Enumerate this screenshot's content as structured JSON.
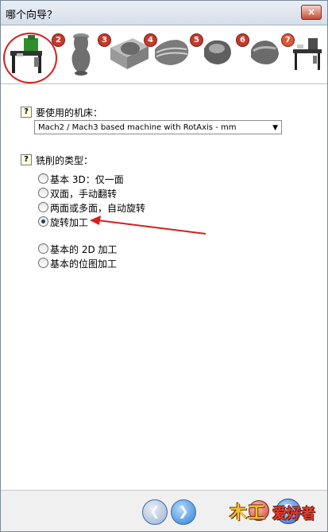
{
  "window": {
    "title": "哪个向导？",
    "close_symbol": "×"
  },
  "steps": [
    {
      "number": "",
      "icon": "cnc-machine-icon",
      "active": true
    },
    {
      "number": "2",
      "icon": "vase-icon"
    },
    {
      "number": "3",
      "icon": "block-icon"
    },
    {
      "number": "4",
      "icon": "lathe-part-icon"
    },
    {
      "number": "5",
      "icon": "cut-part-icon"
    },
    {
      "number": "6",
      "icon": "shape-part-icon"
    },
    {
      "number": "7",
      "icon": "cnc-machine-icon"
    }
  ],
  "machine": {
    "help": "?",
    "label": "要使用的机床：",
    "selected": "Mach2 / Mach3 based machine with RotAxis - mm",
    "arrow": "▼"
  },
  "milling": {
    "help": "?",
    "label": "铣削的类型：",
    "options": [
      {
        "label": "基本 3D：仅一面",
        "checked": false
      },
      {
        "label": "双面，手动翻转",
        "checked": false
      },
      {
        "label": "两面或多面，自动旋转",
        "checked": false
      },
      {
        "label": "旋转加工",
        "checked": true
      }
    ],
    "other_options": [
      {
        "label": "基本的 2D 加工",
        "checked": false
      },
      {
        "label": "基本的位图加工",
        "checked": false
      }
    ]
  },
  "footer": {
    "back_symbol": "❮",
    "next_symbol": "❯",
    "help_symbol": "?",
    "logo_main": "木工",
    "logo_sub": "爱好者"
  },
  "colors": {
    "accent_red": "#d51d1d",
    "nav_blue": "#2a7cd2"
  }
}
